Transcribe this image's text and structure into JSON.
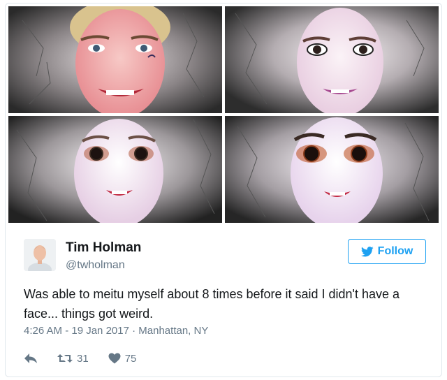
{
  "tweet": {
    "author_name": "Tim Holman",
    "author_handle": "@twholman",
    "follow_label": "Follow",
    "text": "Was able to meitu myself about 8 times before it said I didn't have a face... things got weird.",
    "timestamp": "4:26 AM - 19 Jan 2017",
    "separator": "·",
    "location": "Manhattan, NY",
    "retweet_count": "31",
    "like_count": "75"
  },
  "icons": {
    "follow": "twitter-bird-icon",
    "reply": "reply-icon",
    "retweet": "retweet-icon",
    "like": "heart-icon"
  },
  "colors": {
    "accent": "#1da1f2",
    "secondary_text": "#657786",
    "primary_text": "#14171a",
    "border": "#e1e8ed"
  }
}
